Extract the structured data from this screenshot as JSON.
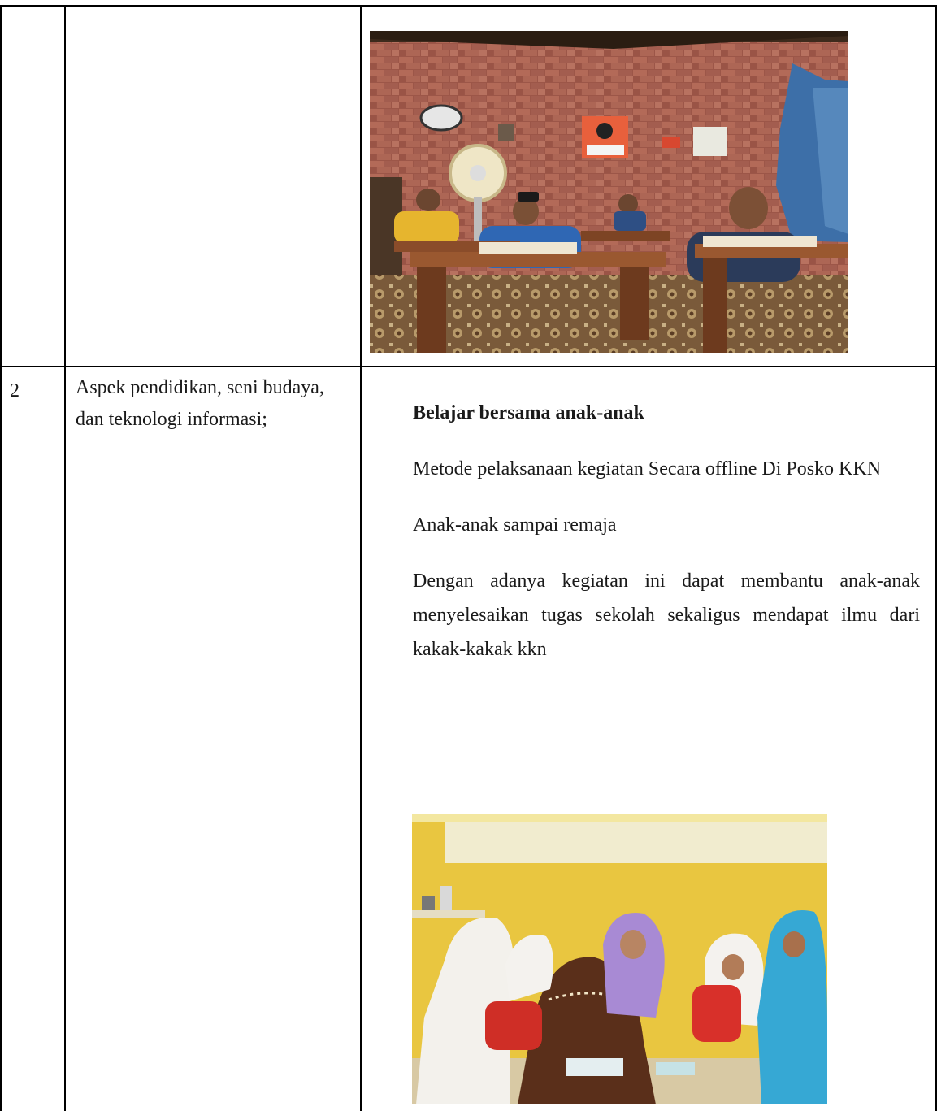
{
  "table": {
    "row_prev": {
      "photo_icon": "photo-classroom-quran-study"
    },
    "row_2": {
      "number": "2",
      "aspect": "Aspek pendidikan, seni budaya, dan teknologi informasi;",
      "activity_title": "Belajar bersama anak-anak",
      "method": "Metode pelaksanaan kegiatan Secara offline Di Posko KKN",
      "target": "Anak-anak sampai remaja",
      "outcome": "Dengan adanya kegiatan ini dapat membantu anak-anak menyelesaikan tugas sekolah sekaligus mendapat ilmu dari kakak-kakak kkn",
      "photo_icon": "photo-children-studying-together"
    }
  },
  "colors": {
    "border": "#000000",
    "text": "#1a1a1a",
    "brick": "#a0584a",
    "wall_yellow": "#e9c640"
  }
}
